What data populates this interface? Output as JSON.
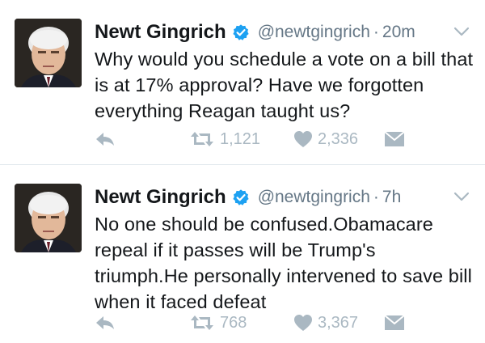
{
  "tweets": [
    {
      "name": "Newt Gingrich",
      "handle": "@newtgingrich",
      "separator": "·",
      "time": "20m",
      "text": "Why would you schedule a vote on a bill that is at 17% approval? Have we forgotten everything Reagan taught us?",
      "retweets": "1,121",
      "likes": "2,336"
    },
    {
      "name": "Newt Gingrich",
      "handle": "@newtgingrich",
      "separator": "·",
      "time": "7h",
      "text": "No one should be confused.Obamacare repeal if it passes will be Trump's triumph.He personally intervened to save bill when it faced defeat",
      "retweets": "768",
      "likes": "3,367"
    }
  ],
  "icons": {
    "verified": "verified-badge-icon",
    "caret": "chevron-down-icon",
    "reply": "reply-icon",
    "retweet": "retweet-icon",
    "like": "heart-icon",
    "dm": "envelope-icon"
  },
  "colors": {
    "verified": "#1da1f2",
    "muted": "#657786",
    "action": "#aab8c2",
    "divider": "#e1e8ed"
  }
}
